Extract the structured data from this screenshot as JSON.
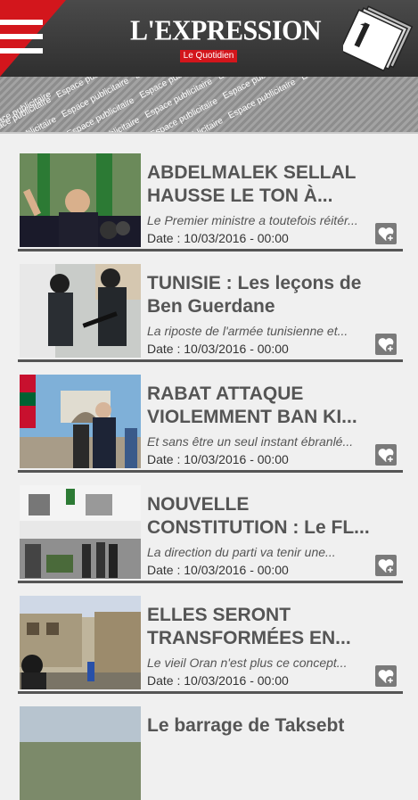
{
  "header": {
    "logo_text": "L'EXPRESSION",
    "logo_subtitle": "Le Quotidien",
    "menu_icon": "hamburger-menu-icon",
    "newspaper_icon": "newspaper-icon",
    "accent_color": "#d3161c"
  },
  "ad_banner": {
    "text": "Espace publicitaire"
  },
  "articles": [
    {
      "title_line1": "ABDELMALEK SELLAL",
      "title_line2": "HAUSSE LE TON À...",
      "summary": "Le Premier ministre a toutefois réitér...",
      "date": "Date : 10/03/2016 - 00:00"
    },
    {
      "title_line1": "TUNISIE : Les leçons de",
      "title_line2": "Ben Guerdane",
      "summary": "La riposte de l'armée tunisienne et...",
      "date": "Date : 10/03/2016 - 00:00"
    },
    {
      "title_line1": "RABAT ATTAQUE",
      "title_line2": "VIOLEMMENT BAN KI...",
      "summary": "Et sans être un seul instant ébranlé...",
      "date": "Date : 10/03/2016 - 00:00"
    },
    {
      "title_line1": "NOUVELLE",
      "title_line2": "CONSTITUTION : Le FL...",
      "summary": "La direction du parti va tenir une...",
      "date": "Date : 10/03/2016 - 00:00"
    },
    {
      "title_line1": "ELLES SERONT",
      "title_line2": "TRANSFORMÉES EN...",
      "summary": "Le vieil Oran n'est plus ce concept...",
      "date": "Date : 10/03/2016 - 00:00"
    },
    {
      "title_line1": "Le barrage de Taksebt",
      "title_line2": "",
      "summary": "",
      "date": ""
    }
  ]
}
